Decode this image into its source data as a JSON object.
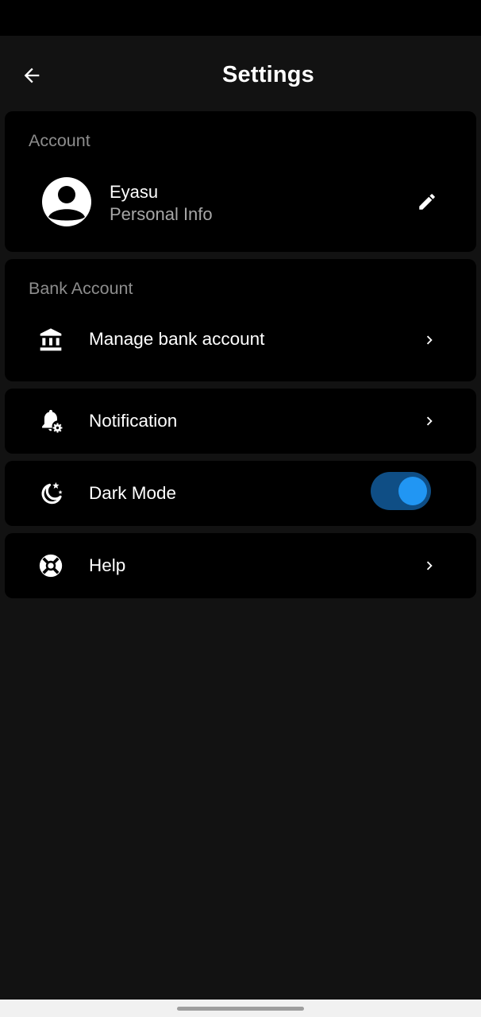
{
  "header": {
    "title": "Settings"
  },
  "account_section": {
    "label": "Account",
    "name": "Eyasu",
    "subtitle": "Personal Info"
  },
  "bank_section": {
    "label": "Bank Account",
    "item_label": "Manage bank account"
  },
  "notification": {
    "label": "Notification"
  },
  "dark_mode": {
    "label": "Dark Mode",
    "enabled": true
  },
  "help": {
    "label": "Help"
  },
  "icons": {
    "back": "arrow-left-icon",
    "avatar": "person-circle-icon",
    "edit": "pencil-icon",
    "bank": "bank-icon",
    "notification": "bell-settings-icon",
    "dark_mode": "moon-stars-icon",
    "help": "lifebuoy-icon",
    "chevron": "chevron-right-icon"
  },
  "colors": {
    "background": "#121212",
    "card": "#000000",
    "accent": "#2196f3",
    "toggle_track": "#0f4e85",
    "muted_text": "#8d8d8d"
  }
}
